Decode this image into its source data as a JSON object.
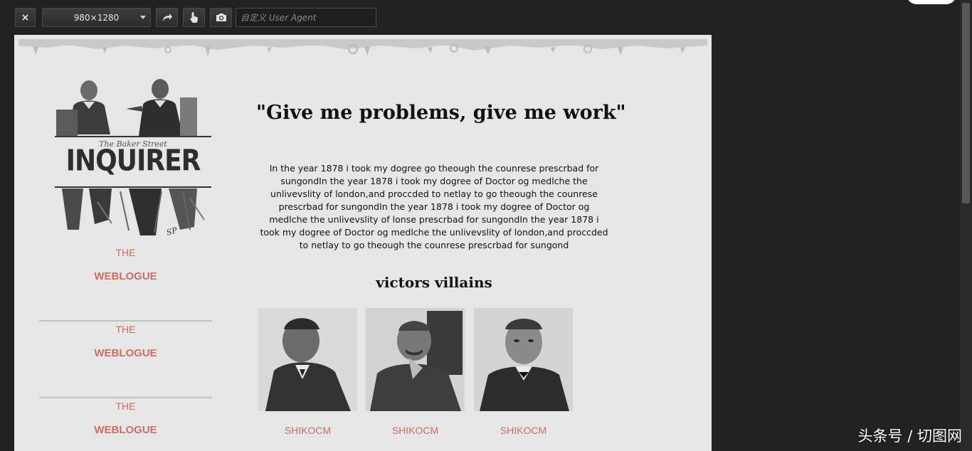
{
  "toolbar": {
    "close_label": "×",
    "size_value": "980×1280",
    "ua_placeholder": "自定义 User Agent"
  },
  "sidebar": {
    "logo_subtitle": "The Baker Street",
    "logo_title": "INQUIRER",
    "logo_signature": "SP",
    "nav": [
      {
        "the": "THE",
        "weblogue": "WEBLOGUE"
      },
      {
        "the": "THE",
        "weblogue": "WEBLOGUE"
      },
      {
        "the": "THE",
        "weblogue": "WEBLOGUE"
      }
    ]
  },
  "main": {
    "quote": "\"Give me problems, give me work\"",
    "body": "In the year 1878 i took my dogree go theough the counrese prescrbad for sungondIn the year 1878 i took my dogree of Doctor og medlche the unlivevslity of london,and proccded to netlay to go theough the counrese prescrbad for sungondIn the year 1878 i took my dogree of Doctor og medlche the unlivevslity of lonse prescrbad for sungondIn the year 1878 i took my dogree of Doctor og medlche the unlivevslity of london,and proccded to netlay to go theough the counrese prescrbad for sungond",
    "section_title": "victors villains",
    "villains": [
      {
        "caption": "SHIKOCM"
      },
      {
        "caption": "SHIKOCM"
      },
      {
        "caption": "SHIKOCM"
      }
    ]
  },
  "watermark": "头条号 / 切图网",
  "colors": {
    "accent": "#cc6e63",
    "page_bg": "#e6e6e6",
    "chrome_bg": "#222222"
  },
  "icons": [
    "close-icon",
    "chevron-down-icon",
    "rotate-icon",
    "touch-icon",
    "camera-icon"
  ]
}
